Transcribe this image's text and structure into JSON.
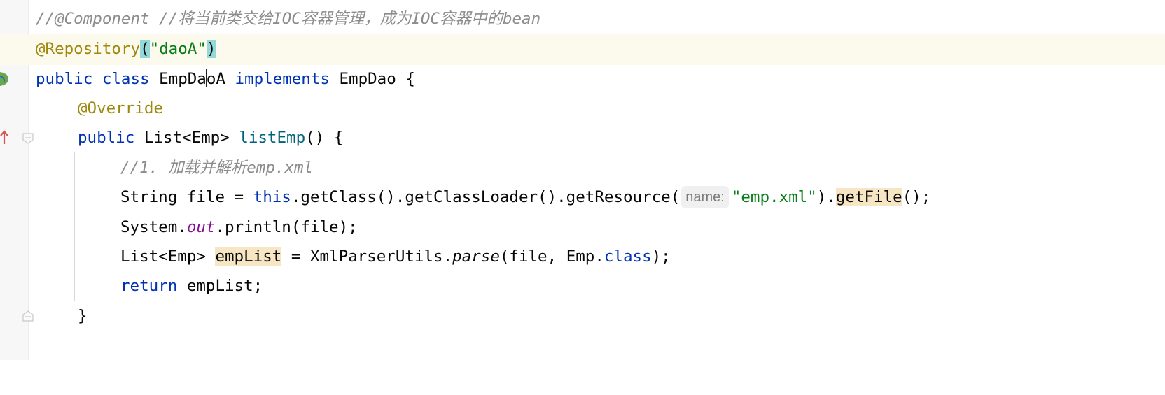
{
  "editor": {
    "lines": {
      "l1": {
        "comment": "//@Component //将当前类交给IOC容器管理，成为IOC容器中的bean"
      },
      "l2": {
        "annotation": "@Repository",
        "open": "(",
        "string": "\"daoA\"",
        "close": ")"
      },
      "l3": {
        "kw1": "public class ",
        "text_a": "EmpDa",
        "text_b": "oA ",
        "kw2": "implements",
        "text_c": " EmpDao {"
      },
      "l4": {
        "annotation": "@Override"
      },
      "l5": {
        "kw": "public ",
        "type": "List<Emp> ",
        "method": "listEmp",
        "rest": "() {"
      },
      "l6": {
        "comment": "//1. 加载并解析emp.xml"
      },
      "l7": {
        "part1": "String file = ",
        "kw_this": "this",
        "part2": ".getClass().getClassLoader().getResource(",
        "hint": "name:",
        "string": "\"emp.xml\"",
        "part3": ").",
        "highlight": "getFile",
        "part4": "();"
      },
      "l8": {
        "part1": "System.",
        "field": "out",
        "part2": ".println(file);"
      },
      "l9": {
        "part1": "List<Emp> ",
        "highlight": "empList",
        "part2": " = XmlParserUtils.",
        "method": "parse",
        "part3": "(file, Emp.",
        "kw": "class",
        "part4": ");"
      },
      "l10": {
        "kw": "return",
        "rest": " empList;"
      },
      "l11": {
        "brace": "}"
      }
    },
    "colors": {
      "keyword": "#0033b3",
      "annotation": "#9e880d",
      "string": "#067d17",
      "comment": "#8c8c8c",
      "current_line": "#fcfaed",
      "brace_match": "#93d9d9",
      "usage_highlight": "#f6e6c3"
    }
  },
  "gutter": {
    "icons": [
      "bean-icon",
      "implements-up-arrow-icon",
      "fold-icon"
    ]
  }
}
